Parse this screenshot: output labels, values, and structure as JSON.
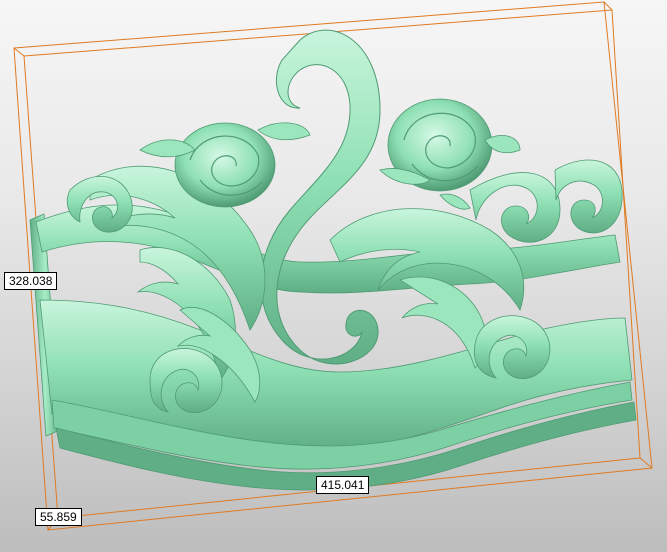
{
  "dimensions": {
    "height": "328.038",
    "width": "415.041",
    "depth": "55.859"
  },
  "colors": {
    "model_base": "#8fe0b4",
    "model_light": "#c8f5dc",
    "model_shadow": "#4f9b74",
    "bounding_box": "#e07a22",
    "background_top": "#f6f6f6",
    "background_bottom": "#bdbdbd"
  }
}
